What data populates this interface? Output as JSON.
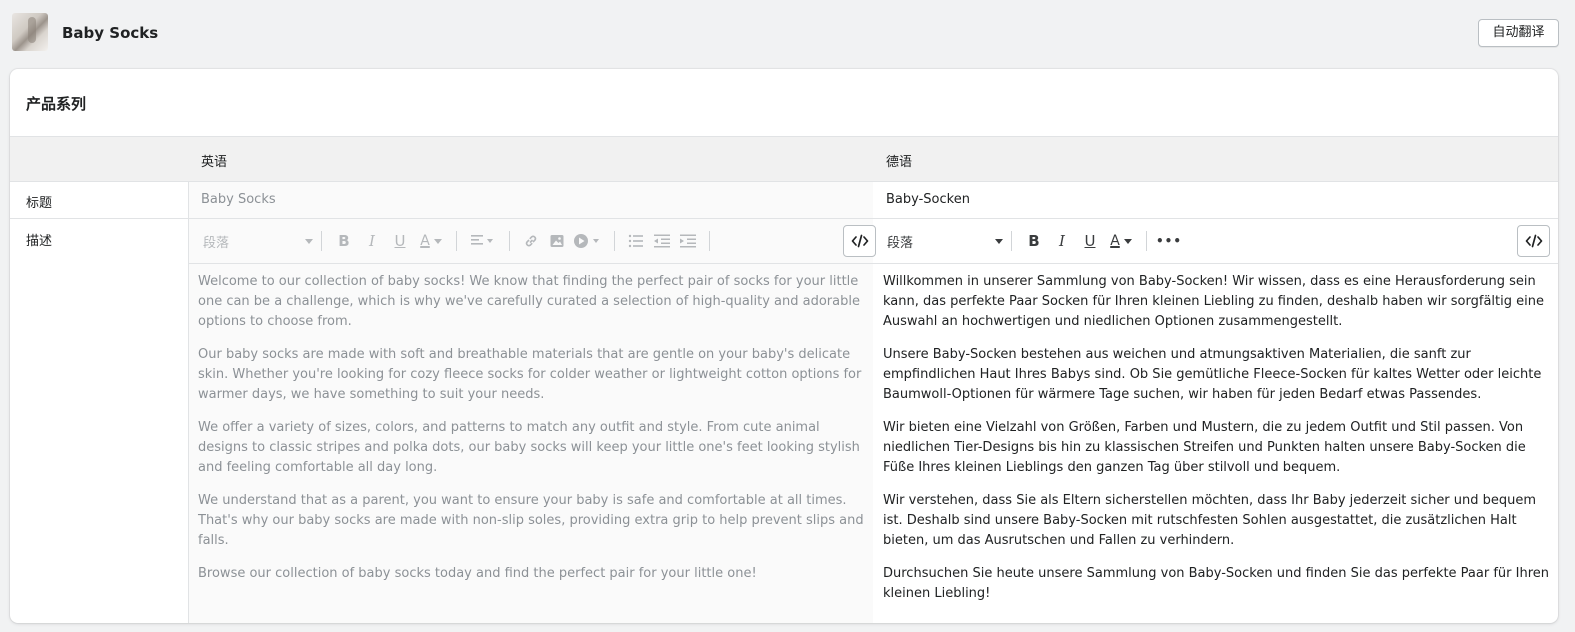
{
  "header": {
    "product_title": "Baby Socks",
    "auto_translate_label": "自动翻译"
  },
  "card": {
    "title": "产品系列",
    "columns": {
      "source": "英语",
      "target": "德语"
    },
    "rows": {
      "title_label": "标题",
      "description_label": "描述"
    },
    "source_title": "Baby Socks",
    "target_title": "Baby-Socken",
    "toolbar": {
      "paragraph_select": "段落",
      "bold": "B",
      "italic": "I",
      "underline": "U",
      "text_color": "A",
      "more": "•••"
    },
    "source_description": [
      "Welcome to our collection of baby socks! We know that finding the perfect pair of socks for your little one can be a challenge, which is why we've carefully curated a selection of high-quality and adorable options to choose from.",
      "Our baby socks are made with soft and breathable materials that are gentle on your baby's delicate skin. Whether you're looking for cozy fleece socks for colder weather or lightweight cotton options for warmer days, we have something to suit your needs.",
      "We offer a variety of sizes, colors, and patterns to match any outfit and style. From cute animal designs to classic stripes and polka dots, our baby socks will keep your little one's feet looking stylish and feeling comfortable all day long.",
      "We understand that as a parent, you want to ensure your baby is safe and comfortable at all times. That's why our baby socks are made with non-slip soles, providing extra grip to help prevent slips and falls.",
      "Browse our collection of baby socks today and find the perfect pair for your little one!"
    ],
    "target_description": [
      "Willkommen in unserer Sammlung von Baby-Socken! Wir wissen, dass es eine Herausforderung sein kann, das perfekte Paar Socken für Ihren kleinen Liebling zu finden, deshalb haben wir sorgfältig eine Auswahl an hochwertigen und niedlichen Optionen zusammengestellt.",
      "Unsere Baby-Socken bestehen aus weichen und atmungsaktiven Materialien, die sanft zur empfindlichen Haut Ihres Babys sind. Ob Sie gemütliche Fleece-Socken für kaltes Wetter oder leichte Baumwoll-Optionen für wärmere Tage suchen, wir haben für jeden Bedarf etwas Passendes.",
      "Wir bieten eine Vielzahl von Größen, Farben und Mustern, die zu jedem Outfit und Stil passen. Von niedlichen Tier-Designs bis hin zu klassischen Streifen und Punkten halten unsere Baby-Socken die Füße Ihres kleinen Lieblings den ganzen Tag über stilvoll und bequem.",
      "Wir verstehen, dass Sie als Eltern sicherstellen möchten, dass Ihr Baby jederzeit sicher und bequem ist. Deshalb sind unsere Baby-Socken mit rutschfesten Sohlen ausgestattet, die zusätzlichen Halt bieten, um das Ausrutschen und Fallen zu verhindern.",
      "Durchsuchen Sie heute unsere Sammlung von Baby-Socken und finden Sie das perfekte Paar für Ihren kleinen Liebling!"
    ]
  }
}
